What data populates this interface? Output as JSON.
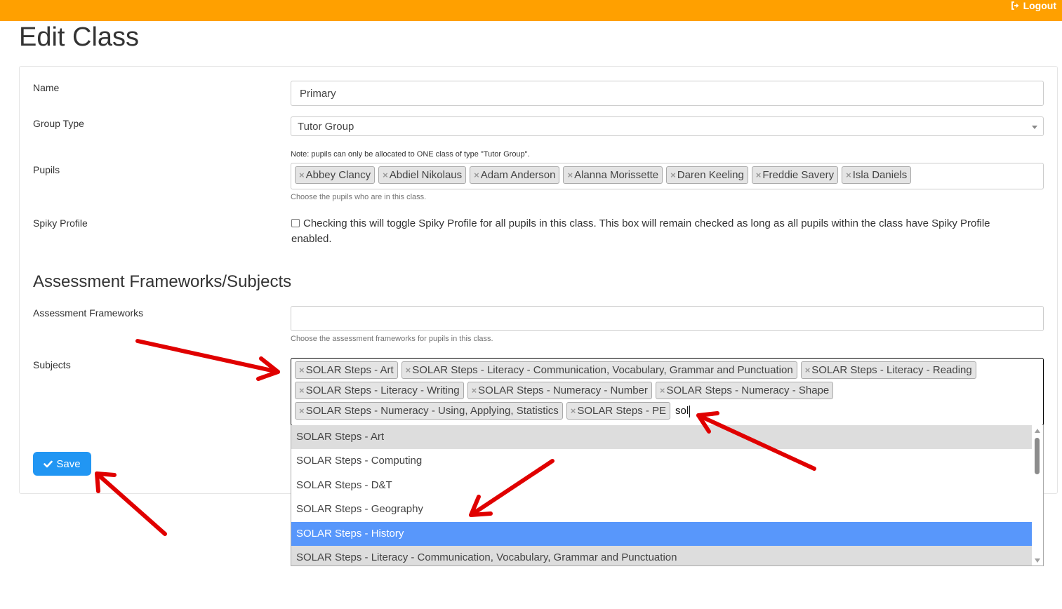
{
  "header": {
    "logout_label": "Logout",
    "logout_icon": "sign-out-icon",
    "bar_color": "#ffa000"
  },
  "page": {
    "title": "Edit Class"
  },
  "form": {
    "name": {
      "label": "Name",
      "value": "Primary"
    },
    "group_type": {
      "label": "Group Type",
      "value": "Tutor Group"
    },
    "pupils": {
      "label": "Pupils",
      "note": "Note: pupils can only be allocated to ONE class of type \"Tutor Group\".",
      "help": "Choose the pupils who are in this class.",
      "tags": [
        "Abbey Clancy",
        "Abdiel Nikolaus",
        "Adam Anderson",
        "Alanna Morissette",
        "Daren Keeling",
        "Freddie Savery",
        "Isla Daniels"
      ]
    },
    "spiky_profile": {
      "label": "Spiky Profile",
      "checked": false,
      "text": "Checking this will toggle Spiky Profile for all pupils in this class. This box will remain checked as long as all pupils within the class have Spiky Profile enabled."
    },
    "section_title": "Assessment Frameworks/Subjects",
    "frameworks": {
      "label": "Assessment Frameworks",
      "value": "",
      "help": "Choose the assessment frameworks for pupils in this class."
    },
    "subjects": {
      "label": "Subjects",
      "tags": [
        "SOLAR Steps - Art",
        "SOLAR Steps - Literacy - Communication, Vocabulary, Grammar and Punctuation",
        "SOLAR Steps - Literacy - Reading",
        "SOLAR Steps - Literacy - Writing",
        "SOLAR Steps - Numeracy - Number",
        "SOLAR Steps - Numeracy - Shape",
        "SOLAR Steps - Numeracy - Using, Applying, Statistics",
        "SOLAR Steps - PE"
      ],
      "search_text": "sol",
      "dropdown": [
        "SOLAR Steps - Art",
        "SOLAR Steps - Computing",
        "SOLAR Steps - D&T",
        "SOLAR Steps - Geography",
        "SOLAR Steps - History",
        "SOLAR Steps - Literacy - Communication, Vocabulary, Grammar and Punctuation"
      ],
      "highlighted_option": "SOLAR Steps - History"
    },
    "save_label": "Save",
    "save_icon": "check-icon",
    "save_color": "#2196f3"
  },
  "annotation_color": "#e00000"
}
